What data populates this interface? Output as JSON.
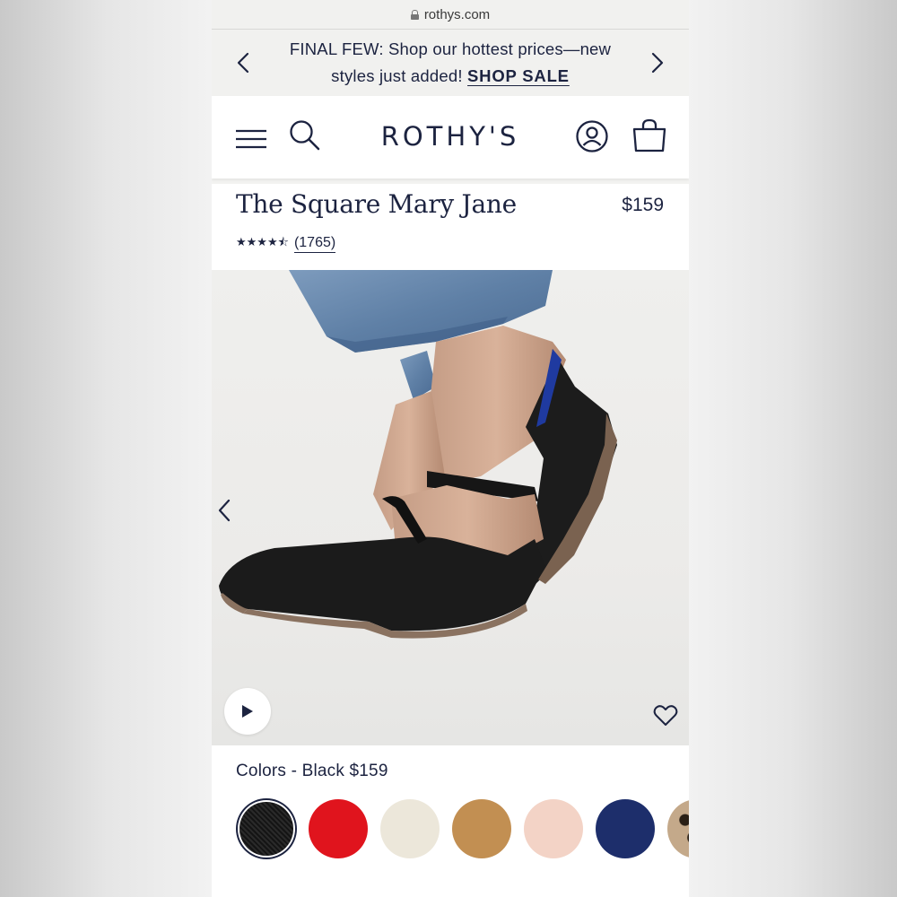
{
  "browser": {
    "url": "rothys.com"
  },
  "promo": {
    "message": "FINAL FEW: Shop our hottest prices—new styles just added!",
    "link_label": "SHOP SALE"
  },
  "header": {
    "logo": "ROTHY'S"
  },
  "product": {
    "title": "The Square Mary Jane",
    "price": "$159",
    "rating": 4.5,
    "stars_display": "★★★★⯪",
    "review_count": "(1765)"
  },
  "colors": {
    "label": "Colors - Black $159",
    "swatches": [
      {
        "name": "black",
        "hex": "#1b1b1b",
        "selected": true
      },
      {
        "name": "red",
        "hex": "#e0141d"
      },
      {
        "name": "cream",
        "hex": "#ece7da"
      },
      {
        "name": "camel",
        "hex": "#c28f52"
      },
      {
        "name": "blush",
        "hex": "#f3d3c6"
      },
      {
        "name": "navy",
        "hex": "#1d2e6b"
      },
      {
        "name": "leopard",
        "hex": "#c4a98a"
      }
    ]
  },
  "theme": {
    "ink": "#1c2340"
  }
}
